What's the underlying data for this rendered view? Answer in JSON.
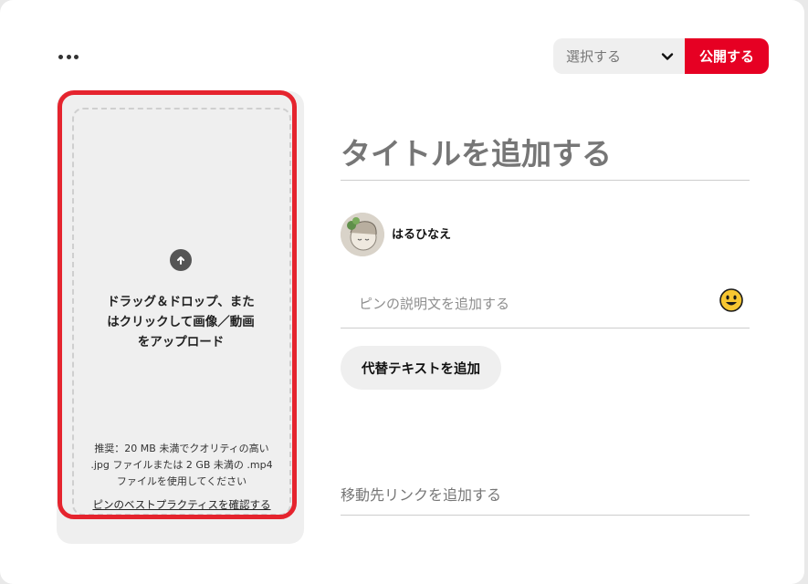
{
  "header": {
    "more_icon": "ellipsis-icon",
    "board_select": {
      "value": "選択する",
      "icon": "chevron-down-icon"
    },
    "publish_label": "公開する"
  },
  "upload": {
    "icon": "arrow-up-circle-icon",
    "instruction": "ドラッグ＆ドロップ、また\nはクリックして画像／動画\nをアップロード",
    "recommendation": "推奨：20 MB 未満でクオリティの高い\n.jpg ファイルまたは 2 GB 未満の .mp4\nファイルを使用してください",
    "best_practices_link": "ピンのベストプラクティスを確認する"
  },
  "form": {
    "title_placeholder": "タイトルを追加する",
    "user": {
      "name": "はるひなえ"
    },
    "description_placeholder": "ピンの説明文を追加する",
    "emoji_icon": "smiley-face-icon",
    "alt_text_button": "代替テキストを追加",
    "link_placeholder": "移動先リンクを追加する"
  },
  "colors": {
    "brand_red": "#e60023",
    "highlight_red": "#e5242e",
    "panel_gray": "#efefef"
  }
}
